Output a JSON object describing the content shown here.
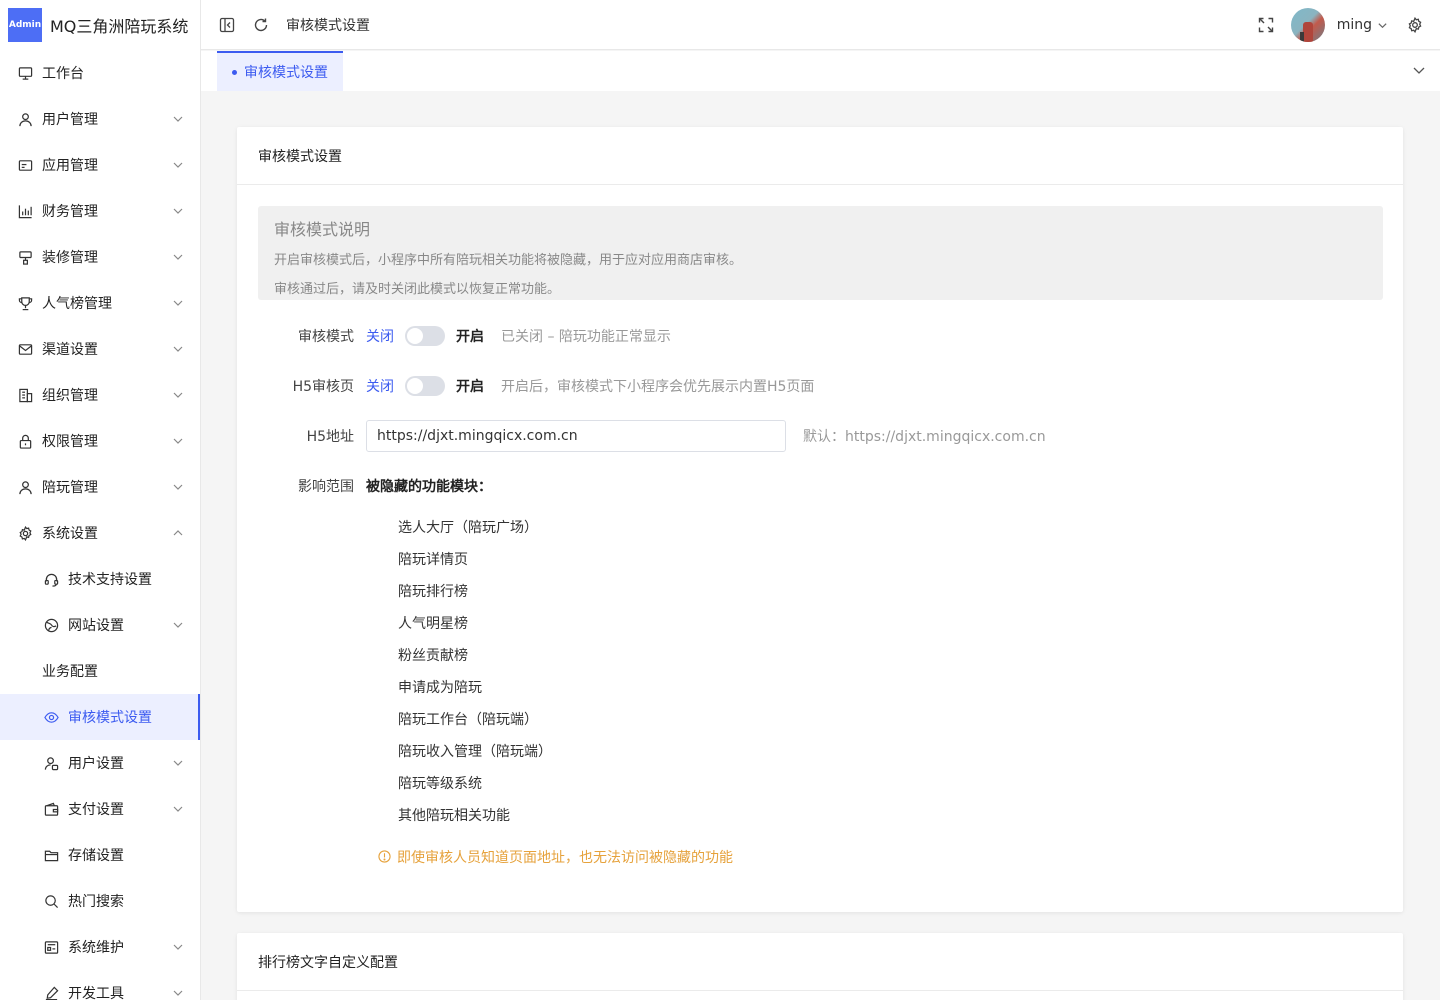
{
  "app": {
    "badge": "Admin",
    "title": "MQ三角洲陪玩系统"
  },
  "sidebar": {
    "items": [
      {
        "label": "工作台",
        "icon": "monitor-icon",
        "chevron": false
      },
      {
        "label": "用户管理",
        "icon": "user-icon",
        "chevron": true
      },
      {
        "label": "应用管理",
        "icon": "app-icon",
        "chevron": true
      },
      {
        "label": "财务管理",
        "icon": "chart-icon",
        "chevron": true
      },
      {
        "label": "装修管理",
        "icon": "decor-icon",
        "chevron": true
      },
      {
        "label": "人气榜管理",
        "icon": "trophy-icon",
        "chevron": true
      },
      {
        "label": "渠道设置",
        "icon": "mail-icon",
        "chevron": true
      },
      {
        "label": "组织管理",
        "icon": "building-icon",
        "chevron": true
      },
      {
        "label": "权限管理",
        "icon": "lock-icon",
        "chevron": true
      },
      {
        "label": "陪玩管理",
        "icon": "person-icon",
        "chevron": true
      },
      {
        "label": "系统设置",
        "icon": "gear-icon",
        "chevron": true,
        "expanded": true
      }
    ],
    "sub_items": [
      {
        "label": "技术支持设置",
        "icon": "headset-icon",
        "chevron": false
      },
      {
        "label": "网站设置",
        "icon": "globe-icon",
        "chevron": true
      },
      {
        "label": "业务配置",
        "icon": "",
        "chevron": false
      },
      {
        "label": "审核模式设置",
        "icon": "eye-icon",
        "chevron": false,
        "active": true
      },
      {
        "label": "用户设置",
        "icon": "user-settings-icon",
        "chevron": true
      },
      {
        "label": "支付设置",
        "icon": "wallet-icon",
        "chevron": true
      },
      {
        "label": "存储设置",
        "icon": "folder-icon",
        "chevron": false
      },
      {
        "label": "热门搜索",
        "icon": "search-icon",
        "chevron": false
      },
      {
        "label": "系统维护",
        "icon": "maintenance-icon",
        "chevron": true
      },
      {
        "label": "开发工具",
        "icon": "tool-icon",
        "chevron": true
      }
    ]
  },
  "header": {
    "breadcrumb": "审核模式设置",
    "username": "ming"
  },
  "tabs": [
    {
      "label": "审核模式设置"
    }
  ],
  "card": {
    "title": "审核模式设置",
    "notice": {
      "title": "审核模式说明",
      "line1": "开启审核模式后，小程序中所有陪玩相关功能将被隐藏，用于应对应用商店审核。",
      "line2": "审核通过后，请及时关闭此模式以恢复正常功能。"
    },
    "review_mode": {
      "label": "审核模式",
      "off": "关闭",
      "on": "开启",
      "hint": "已关闭 – 陪玩功能正常显示"
    },
    "h5_review": {
      "label": "H5审核页",
      "off": "关闭",
      "on": "开启",
      "hint": "开启后，审核模式下小程序会优先展示内置H5页面"
    },
    "h5_url": {
      "label": "H5地址",
      "value": "https://djxt.mingqicx.com.cn",
      "hint": "默认：https://djxt.mingqicx.com.cn"
    },
    "scope": {
      "label": "影响范围",
      "title": "被隐藏的功能模块：",
      "modules": [
        "选人大厅（陪玩广场）",
        "陪玩详情页",
        "陪玩排行榜",
        "人气明星榜",
        "粉丝贡献榜",
        "申请成为陪玩",
        "陪玩工作台（陪玩端）",
        "陪玩收入管理（陪玩端）",
        "陪玩等级系统",
        "其他陪玩相关功能"
      ],
      "warning": "即使审核人员知道页面地址，也无法访问被隐藏的功能"
    }
  },
  "card2": {
    "title": "排行榜文字自定义配置"
  },
  "colors": {
    "accent": "#3c5bf0",
    "warning": "#e6a23c"
  }
}
